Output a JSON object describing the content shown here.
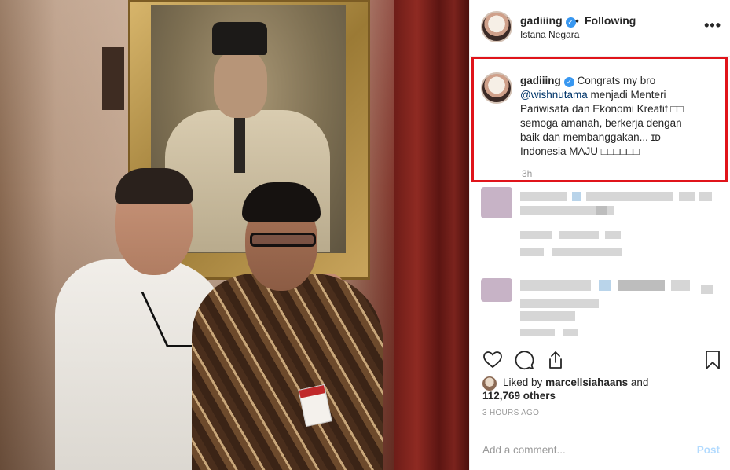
{
  "post": {
    "username": "gadiiing",
    "verified_mark": "✓",
    "separator": "•",
    "follow_status": "Following",
    "location": "Istana Negara",
    "more_icon": "•••"
  },
  "caption": {
    "username": "gadiiing",
    "text_before_mention": "Congrats my bro",
    "mention": "@wishnutama",
    "text_after_mention": "menjadi Menteri Pariwisata dan Ekonomi Kreatif □□ semoga amanah, berkerja dengan baik dan membanggakan... ɪᴅ Indonesia MAJU □□□□□□",
    "time": "3h"
  },
  "actions": {
    "like_icon": "heart-icon",
    "comment_icon": "comment-icon",
    "share_icon": "share-icon",
    "save_icon": "bookmark-icon"
  },
  "likes": {
    "prefix": "Liked by",
    "user": "marcellsiahaans",
    "conj": "and",
    "others": "112,769 others"
  },
  "timestamp": "3 HOURS AGO",
  "comment_input": {
    "placeholder": "Add a comment...",
    "post_label": "Post"
  },
  "colors": {
    "highlight_box": "#e0141b",
    "verified": "#3897f0",
    "mention": "#003569",
    "post_disabled": "#b3dbff"
  }
}
